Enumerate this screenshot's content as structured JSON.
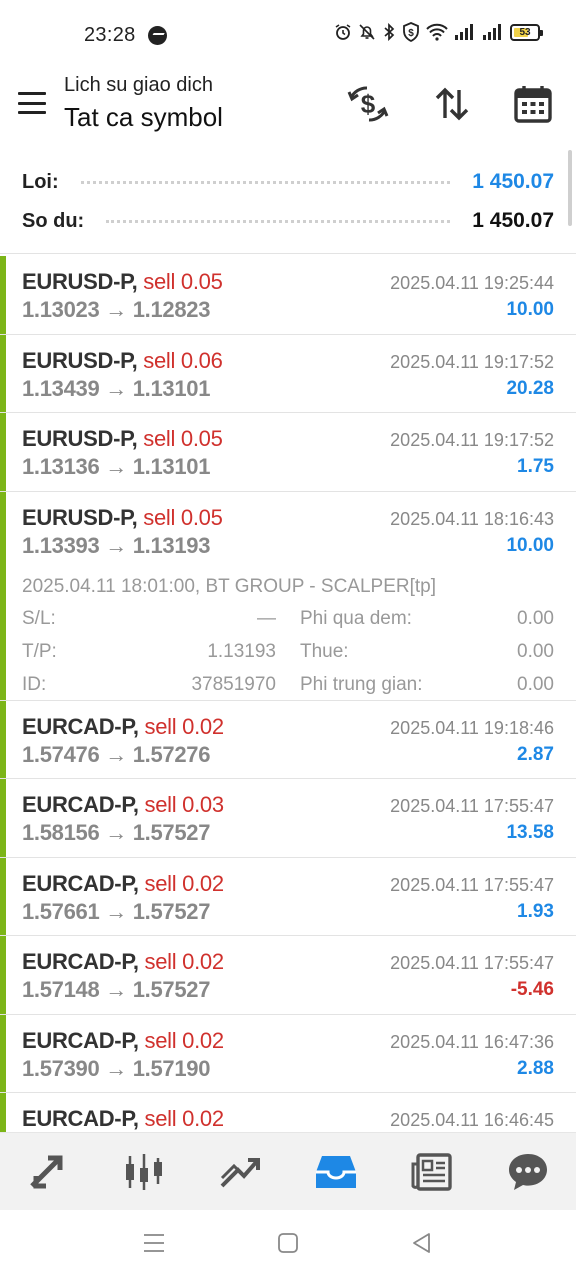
{
  "status_bar": {
    "time": "23:28",
    "battery": "53",
    "icons": [
      "messenger-icon",
      "alarm-icon",
      "mute-icon",
      "bluetooth-icon",
      "vpn-shield-icon",
      "wifi-icon",
      "signal-icon",
      "signal-icon",
      "battery-icon"
    ]
  },
  "header": {
    "subtitle": "Lich su giao dich",
    "title": "Tat ca symbol",
    "actions": [
      "currency-exchange-icon",
      "sort-icon",
      "calendar-icon"
    ]
  },
  "summary": {
    "profit_label": "Loi:",
    "profit_value": "1 450.07",
    "balance_label": "So du:",
    "balance_value": "1 450.07",
    "profit_color": "#1e88e5",
    "balance_color": "#111111"
  },
  "deals": [
    {
      "symbol": "EURUSD-P,",
      "type": "sell 0.05",
      "prices": "1.13023 → 1.12823",
      "time": "2025.04.11 19:25:44",
      "profit": "10.00"
    },
    {
      "symbol": "EURUSD-P,",
      "type": "sell 0.06",
      "prices": "1.13439 → 1.13101",
      "time": "2025.04.11 19:17:52",
      "profit": "20.28"
    },
    {
      "symbol": "EURUSD-P,",
      "type": "sell 0.05",
      "prices": "1.13136 → 1.13101",
      "time": "2025.04.11 19:17:52",
      "profit": "1.75"
    },
    {
      "symbol": "EURUSD-P,",
      "type": "sell 0.05",
      "prices": "1.13393 → 1.13193",
      "time": "2025.04.11 18:16:43",
      "profit": "10.00",
      "details": {
        "comment": "2025.04.11 18:01:00, BT GROUP - SCALPER[tp]",
        "sl_label": "S/L:",
        "sl_value": "—",
        "tp_label": "T/P:",
        "tp_value": "1.13193",
        "id_label": "ID:",
        "id_value": "37851970",
        "swap_label": "Phi qua dem:",
        "swap_value": "0.00",
        "tax_label": "Thue:",
        "tax_value": "0.00",
        "commission_label": "Phi trung gian:",
        "commission_value": "0.00"
      }
    },
    {
      "symbol": "EURCAD-P,",
      "type": "sell 0.02",
      "prices": "1.57476 → 1.57276",
      "time": "2025.04.11 19:18:46",
      "profit": "2.87"
    },
    {
      "symbol": "EURCAD-P,",
      "type": "sell 0.03",
      "prices": "1.58156 → 1.57527",
      "time": "2025.04.11 17:55:47",
      "profit": "13.58"
    },
    {
      "symbol": "EURCAD-P,",
      "type": "sell 0.02",
      "prices": "1.57661 → 1.57527",
      "time": "2025.04.11 17:55:47",
      "profit": "1.93"
    },
    {
      "symbol": "EURCAD-P,",
      "type": "sell 0.02",
      "prices": "1.57148 → 1.57527",
      "time": "2025.04.11 17:55:47",
      "profit": "-5.46"
    },
    {
      "symbol": "EURCAD-P,",
      "type": "sell 0.02",
      "prices": "1.57390 → 1.57190",
      "time": "2025.04.11 16:47:36",
      "profit": "2.88"
    },
    {
      "symbol": "EURCAD-P,",
      "type": "sell 0.02",
      "prices": "",
      "time": "2025.04.11 16:46:45",
      "profit": ""
    }
  ],
  "colors": {
    "positive": "#1e88e5",
    "negative": "#d0312d",
    "sell": "#d0312d",
    "accent_bar": "#7cb518",
    "nav_active": "#1e88e5"
  },
  "bottom_nav": [
    "quotes-icon",
    "chart-icon",
    "trade-icon",
    "history-icon",
    "news-icon",
    "chat-icon"
  ],
  "system_nav": [
    "recent-apps-icon",
    "home-icon",
    "back-icon"
  ]
}
